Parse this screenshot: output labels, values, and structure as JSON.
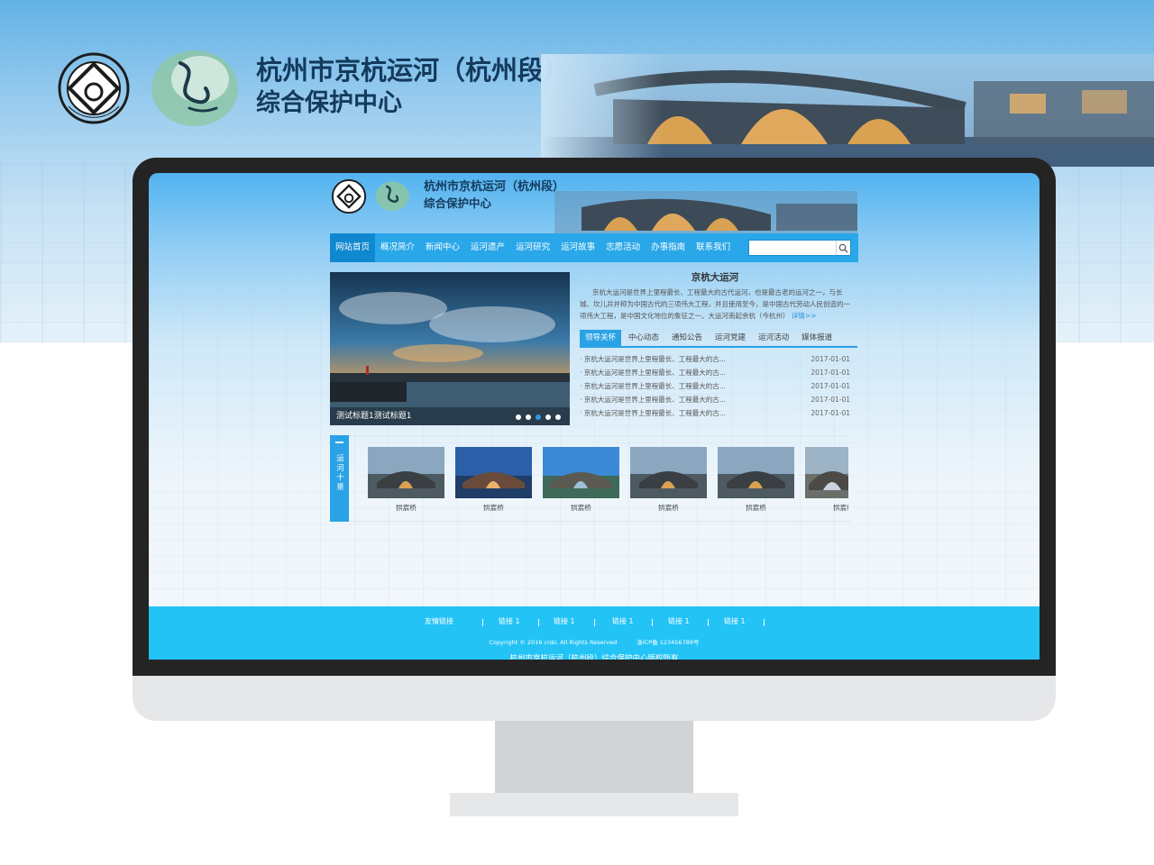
{
  "header": {
    "title": "杭州市京杭运河（杭州段）",
    "subtitle": "综合保护中心"
  },
  "nav": {
    "items": [
      "网站首页",
      "概况简介",
      "新闻中心",
      "运河遗产",
      "运河研究",
      "运河故事",
      "志愿活动",
      "办事指南",
      "联系我们"
    ],
    "active_index": 0,
    "search_placeholder": ""
  },
  "slider": {
    "caption": "测试标题1测试标题1",
    "dot_count": 5,
    "active_dot": 3
  },
  "intro": {
    "title": "京杭大运河",
    "text": "京杭大运河是世界上里程最长、工程最大的古代运河，也是最古老的运河之一，与长城、坎儿井并称为中国古代的三项伟大工程，并且使用至今，是中国古代劳动人民创造的一项伟大工程，是中国文化地位的象征之一。大运河南起余杭（今杭州）",
    "more": "详情>>"
  },
  "tabs": [
    "领导关怀",
    "中心动态",
    "通知公告",
    "运河党建",
    "运河活动",
    "媒体报道"
  ],
  "tab_active_index": 0,
  "news": [
    {
      "title": "· 京杭大运河是世界上里程最长、工程最大的古...",
      "date": "2017-01-01"
    },
    {
      "title": "· 京杭大运河是世界上里程最长、工程最大的古...",
      "date": "2017-01-01"
    },
    {
      "title": "· 京杭大运河是世界上里程最长、工程最大的古...",
      "date": "2017-01-01"
    },
    {
      "title": "· 京杭大运河是世界上里程最长、工程最大的古...",
      "date": "2017-01-01"
    },
    {
      "title": "· 京杭大运河是世界上里程最长、工程最大的古...",
      "date": "2017-01-01"
    }
  ],
  "gallery": {
    "label": "运河十景",
    "items": [
      {
        "caption": "拱宸桥"
      },
      {
        "caption": "拱宸桥"
      },
      {
        "caption": "拱宸桥"
      },
      {
        "caption": "拱宸桥"
      },
      {
        "caption": "拱宸桥"
      },
      {
        "caption": "拱宸桥"
      }
    ]
  },
  "footer": {
    "links_title": "友情链接",
    "links": [
      "链接 1",
      "链接 1",
      "链接 1",
      "链接 1",
      "链接 1"
    ],
    "copyright": "Copyright © 2016 cnbi. All Rights Reserved",
    "icp": "浙ICP备 123456789号",
    "owner": "杭州市京杭运河（杭州段）综合保护中心版权所有"
  },
  "colors": {
    "nav_bg": "#29a7e8",
    "nav_active": "#0f88cf",
    "footer_bg": "#23c3f6",
    "accent": "#2aa3e6",
    "title_text": "#143a5c"
  },
  "icons": {
    "search": "search-icon",
    "world-heritage-logo": "world-heritage-logo",
    "canal-logo": "canal-logo"
  }
}
